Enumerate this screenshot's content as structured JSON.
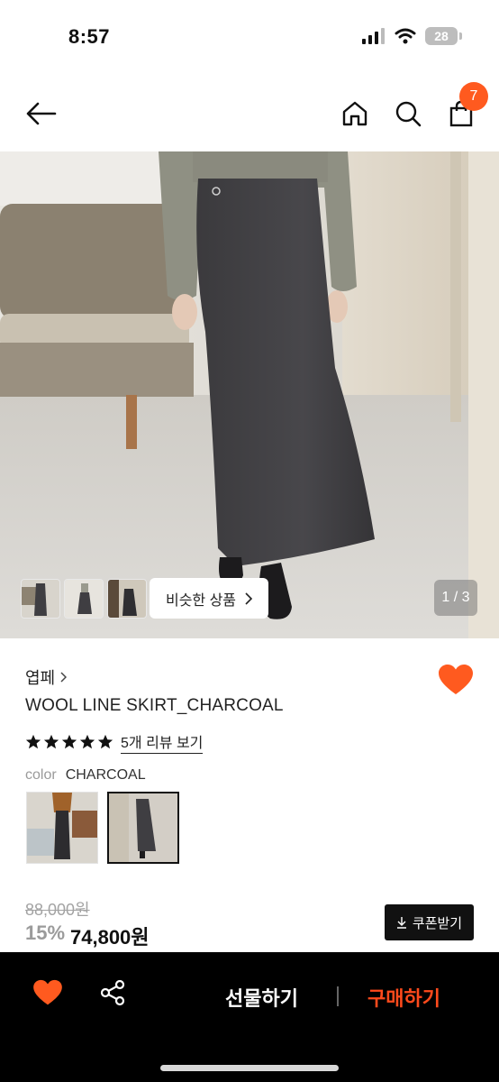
{
  "status_bar": {
    "time": "8:57",
    "battery": "28"
  },
  "header": {
    "cart_count": "7"
  },
  "gallery": {
    "similar_button": "비슷한 상품",
    "page_indicator": "1 / 3"
  },
  "product": {
    "brand": "엽페",
    "name": "WOOL LINE SKIRT_CHARCOAL",
    "rating_stars": 5,
    "review_link": "5개 리뷰 보기",
    "option_label": "color",
    "option_value": "CHARCOAL",
    "original_price": "88,000원",
    "discount_rate": "15%",
    "sale_price": "74,800원",
    "coupon_button": "쿠폰받기"
  },
  "bottom_bar": {
    "gift_button": "선물하기",
    "buy_button": "구매하기"
  },
  "colors": {
    "accent": "#ff5a1f",
    "buy": "#ff4a1c",
    "wishlist": "#ff5a1f",
    "bar_bg": "#000000"
  },
  "icons": [
    "back-arrow-icon",
    "home-icon",
    "search-icon",
    "shopping-bag-icon",
    "heart-icon",
    "share-icon",
    "download-icon",
    "star-icon",
    "chevron-right-icon"
  ]
}
